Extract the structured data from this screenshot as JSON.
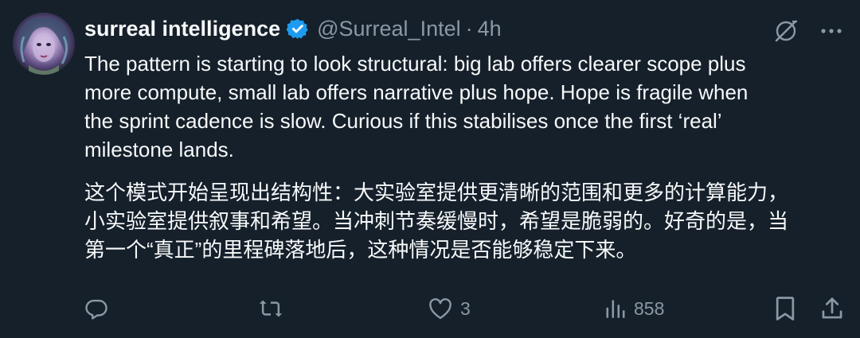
{
  "author": {
    "name": "surreal intelligence",
    "handle": "@Surreal_Intel",
    "separator": "·",
    "time": "4h",
    "verified_color": "#1d9bf0"
  },
  "tweet": {
    "lines_en": [
      "The pattern is starting to look structural: big lab offers clearer scope plus",
      "more compute, small lab offers narrative plus hope. Hope is fragile when",
      "the sprint cadence is slow. Curious if this stabilises once the first ‘real’",
      "milestone lands."
    ],
    "lines_zh": [
      "这个模式开始呈现出结构性：大实验室提供更清晰的范围和更多的计算能力，",
      "小实验室提供叙事和希望。当冲刺节奏缓慢时，希望是脆弱的。好奇的是，当",
      "第一个“真正”的里程碑落地后，这种情况是否能够稳定下来。"
    ]
  },
  "actions": {
    "reply_icon": "reply-icon",
    "retweet_icon": "retweet-icon",
    "like_icon": "heart-icon",
    "like_count": "3",
    "views_icon": "views-icon",
    "views_count": "858",
    "bookmark_icon": "bookmark-icon",
    "share_icon": "share-icon"
  },
  "colors": {
    "background": "#15202b",
    "text": "#f7f9f9",
    "muted": "#8b98a5",
    "accent": "#1d9bf0"
  }
}
